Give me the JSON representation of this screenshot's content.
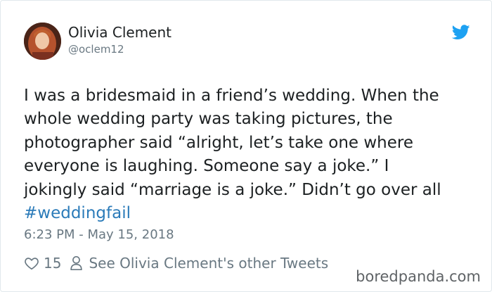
{
  "author": {
    "display_name": "Olivia Clement",
    "handle": "@oclem12"
  },
  "tweet": {
    "text_lines": [
      "I was a bridesmaid in a friend’s wedding. When the",
      "whole wedding party was taking pictures, the",
      "photographer said “alright, let’s take one where",
      "everyone is laughing. Someone say a joke.” I",
      "jokingly said “marriage is a joke.” Didn’t go over all"
    ],
    "hashtag": "#weddingfail",
    "timestamp": "6:23 PM - May 15, 2018"
  },
  "actions": {
    "like_count": "15",
    "profile_link_text": "See Olivia Clement's other Tweets"
  },
  "watermark": "boredpanda.com",
  "icons": {
    "brand": "twitter-bird-icon",
    "like": "heart-icon",
    "profile": "person-icon"
  },
  "colors": {
    "twitter_blue": "#1da1f2",
    "hashtag": "#2b7bb9",
    "muted": "#697882",
    "text": "#1c2022"
  }
}
